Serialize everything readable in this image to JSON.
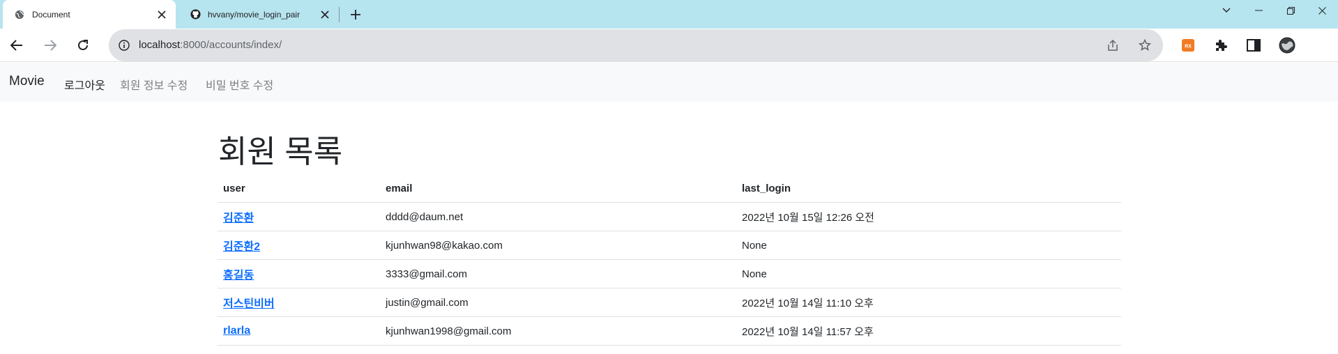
{
  "browser": {
    "tabs": [
      {
        "title": "Document",
        "icon": "globe-icon"
      },
      {
        "title": "hvvany/movie_login_pair",
        "icon": "github-icon"
      }
    ],
    "url": {
      "host": "localhost",
      "rest": ":8000/accounts/index/"
    },
    "extension_badge": "RX"
  },
  "navbar": {
    "brand": "Movie",
    "links": [
      "로그아웃",
      "회원 정보 수정",
      "비밀 번호 수정"
    ]
  },
  "main": {
    "title": "회원 목록",
    "table": {
      "headers": [
        "user",
        "email",
        "last_login"
      ],
      "rows": [
        {
          "user": "김준환",
          "email": "dddd@daum.net",
          "last_login": "2022년 10월 15일 12:26 오전"
        },
        {
          "user": "김준환2",
          "email": "kjunhwan98@kakao.com",
          "last_login": "None"
        },
        {
          "user": "홍길동",
          "email": "3333@gmail.com",
          "last_login": "None"
        },
        {
          "user": "저스틴비버",
          "email": "justin@gmail.com",
          "last_login": "2022년 10월 14일 11:10 오후"
        },
        {
          "user": "rlarla",
          "email": "kjunhwan1998@gmail.com",
          "last_login": "2022년 10월 14일 11:57 오후"
        }
      ]
    }
  },
  "colors": {
    "tabstrip": "#b6e4ef",
    "link": "#0d6efd",
    "navbar_bg": "#f8f9fa"
  }
}
